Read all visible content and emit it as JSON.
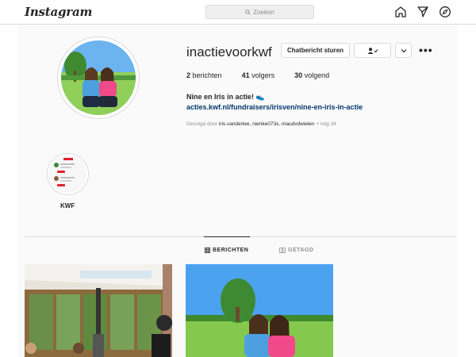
{
  "nav": {
    "logo": "Instagram",
    "search_placeholder": "Zoeken"
  },
  "profile": {
    "username": "inactievoorkwf",
    "message_button": "Chatbericht sturen",
    "posts_count": "2",
    "posts_label": "berichten",
    "followers_count": "41",
    "followers_label": "volgers",
    "following_count": "30",
    "following_label": "volgend",
    "full_name": "Nine en Iris in actie!",
    "full_name_emoji": "👟",
    "link": "acties.kwf.nl/fundraisers/irisven/nine-en-iris-in-actie",
    "followed_prefix": "Gevolgd door",
    "followed_names": "iris.vanderlee, nienke073x, maudvdwielen",
    "followed_suffix": "+ nog 34"
  },
  "highlights": [
    {
      "label": "KWF"
    }
  ],
  "tabs": [
    {
      "label": "BERICHTEN",
      "active": true
    },
    {
      "label": "GETAGD",
      "active": false
    }
  ],
  "colors": {
    "link": "#00376b",
    "border": "#dbdbdb",
    "muted": "#8e8e8e",
    "text": "#262626"
  }
}
